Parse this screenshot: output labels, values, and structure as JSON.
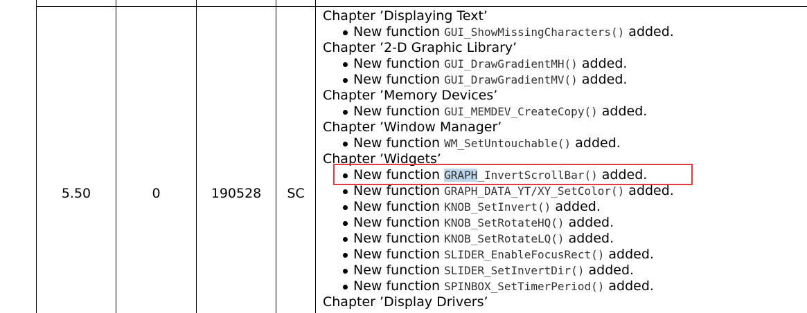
{
  "row": {
    "version": "5.50",
    "revision": "0",
    "date": "190528",
    "author": "SC"
  },
  "content": [
    {
      "kind": "chapter",
      "text": "Chapter ’Displaying Text’"
    },
    {
      "kind": "item",
      "prefix": "New function",
      "code": "GUI_ShowMissingCharacters()",
      "suffix": "added."
    },
    {
      "kind": "chapter",
      "text": "Chapter ’2-D Graphic Library’"
    },
    {
      "kind": "item",
      "prefix": "New function",
      "code": "GUI_DrawGradientMH()",
      "suffix": "added."
    },
    {
      "kind": "item",
      "prefix": "New function",
      "code": "GUI_DrawGradientMV()",
      "suffix": "added."
    },
    {
      "kind": "chapter",
      "text": "Chapter ’Memory Devices’"
    },
    {
      "kind": "item",
      "prefix": "New function",
      "code": "GUI_MEMDEV_CreateCopy()",
      "suffix": "added."
    },
    {
      "kind": "chapter",
      "text": "Chapter ’Window Manager’"
    },
    {
      "kind": "item",
      "prefix": "New function",
      "code": "WM_SetUntouchable()",
      "suffix": "added."
    },
    {
      "kind": "chapter",
      "text": "Chapter ’Widgets’"
    },
    {
      "kind": "item",
      "prefix": "New function",
      "code_hl": "GRAPH",
      "code": "_InvertScrollBar()",
      "suffix": "added.",
      "highlighted": true
    },
    {
      "kind": "item",
      "prefix": "New function",
      "code": "GRAPH_DATA_YT/XY_SetColor()",
      "suffix": "added."
    },
    {
      "kind": "item",
      "prefix": "New function",
      "code": "KNOB_SetInvert()",
      "suffix": "added."
    },
    {
      "kind": "item",
      "prefix": "New function",
      "code": "KNOB_SetRotateHQ()",
      "suffix": "added."
    },
    {
      "kind": "item",
      "prefix": "New function",
      "code": "KNOB_SetRotateLQ()",
      "suffix": "added."
    },
    {
      "kind": "item",
      "prefix": "New function",
      "code": "SLIDER_EnableFocusRect()",
      "suffix": "added."
    },
    {
      "kind": "item",
      "prefix": "New function",
      "code": "SLIDER_SetInvertDir()",
      "suffix": "added."
    },
    {
      "kind": "item",
      "prefix": "New function",
      "code": "SPINBOX_SetTimerPeriod()",
      "suffix": "added."
    },
    {
      "kind": "chapter",
      "text": "Chapter ’Display Drivers’"
    }
  ],
  "colors": {
    "highlight_box": "#e0393e",
    "selection": "#bcd6ec"
  }
}
